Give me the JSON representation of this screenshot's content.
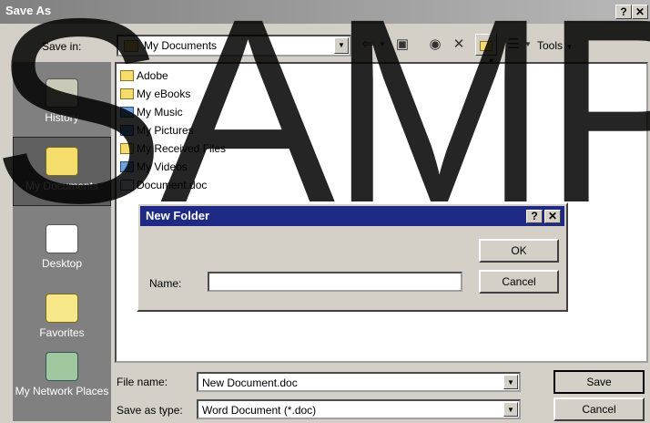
{
  "window": {
    "title": "Save As",
    "help_btn": "?",
    "close_btn": "✕"
  },
  "toolbar": {
    "save_in_label": "Save in:",
    "save_in_value": "My Documents",
    "tools_label": "Tools"
  },
  "places": [
    {
      "label": "History",
      "icon": "history-icon"
    },
    {
      "label": "My Documents",
      "icon": "my-documents-icon"
    },
    {
      "label": "Desktop",
      "icon": "desktop-icon"
    },
    {
      "label": "Favorites",
      "icon": "favorites-icon"
    },
    {
      "label": "My Network Places",
      "icon": "network-icon"
    }
  ],
  "files": [
    {
      "name": "Adobe",
      "kind": "folder"
    },
    {
      "name": "My eBooks",
      "kind": "folder"
    },
    {
      "name": "My Music",
      "kind": "special"
    },
    {
      "name": "My Pictures",
      "kind": "special"
    },
    {
      "name": "My Received Files",
      "kind": "folder"
    },
    {
      "name": "My Videos",
      "kind": "special"
    },
    {
      "name": "Document.doc",
      "kind": "doc"
    }
  ],
  "new_folder_dialog": {
    "title": "New Folder",
    "help_btn": "?",
    "close_btn": "✕",
    "name_label": "Name:",
    "name_value": "",
    "ok_label": "OK",
    "cancel_label": "Cancel"
  },
  "bottom": {
    "file_name_label": "File name:",
    "file_name_value": "New Document.doc",
    "save_as_type_label": "Save as type:",
    "save_as_type_value": "Word Document (*.doc)",
    "save_label": "Save",
    "cancel_label": "Cancel"
  },
  "watermark": "SAMPLE",
  "colors": {
    "dialog_title": "#1e2a86",
    "places_bg": "#808080",
    "face": "#d4d0c8"
  }
}
